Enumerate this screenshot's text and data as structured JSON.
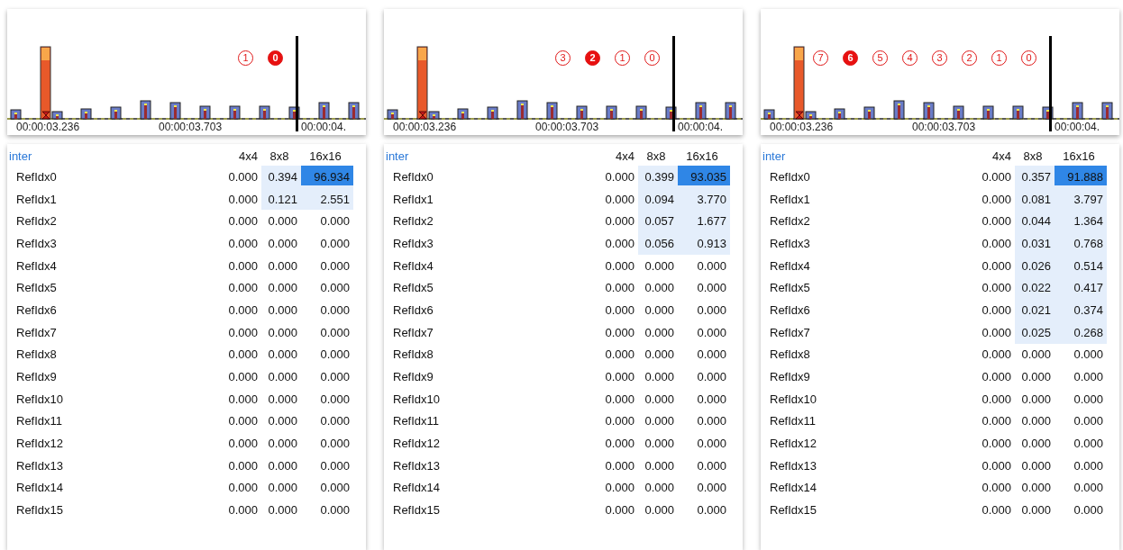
{
  "panels": [
    {
      "timeline": {
        "markers": [
          {
            "text": "1",
            "selected": false
          },
          {
            "text": "0",
            "selected": true
          }
        ],
        "times": [
          "00:00:03.236",
          "00:00:03.703",
          "00:00:04."
        ]
      },
      "table": {
        "title": "inter",
        "columns": [
          "4x4",
          "8x8",
          "16x16"
        ],
        "rows": [
          {
            "label": "RefIdx0",
            "cells": [
              {
                "value": "0.000",
                "highlighted": false,
                "selected": false
              },
              {
                "value": "0.394",
                "highlighted": true,
                "selected": false
              },
              {
                "value": "96.934",
                "highlighted": true,
                "selected": true
              }
            ]
          },
          {
            "label": "RefIdx1",
            "cells": [
              {
                "value": "0.000",
                "highlighted": false,
                "selected": false
              },
              {
                "value": "0.121",
                "highlighted": true,
                "selected": false
              },
              {
                "value": "2.551",
                "highlighted": true,
                "selected": false
              }
            ]
          },
          {
            "label": "RefIdx2",
            "cells": [
              {
                "value": "0.000",
                "highlighted": false,
                "selected": false
              },
              {
                "value": "0.000",
                "highlighted": false,
                "selected": false
              },
              {
                "value": "0.000",
                "highlighted": false,
                "selected": false
              }
            ]
          },
          {
            "label": "RefIdx3",
            "cells": [
              {
                "value": "0.000",
                "highlighted": false,
                "selected": false
              },
              {
                "value": "0.000",
                "highlighted": false,
                "selected": false
              },
              {
                "value": "0.000",
                "highlighted": false,
                "selected": false
              }
            ]
          },
          {
            "label": "RefIdx4",
            "cells": [
              {
                "value": "0.000",
                "highlighted": false,
                "selected": false
              },
              {
                "value": "0.000",
                "highlighted": false,
                "selected": false
              },
              {
                "value": "0.000",
                "highlighted": false,
                "selected": false
              }
            ]
          },
          {
            "label": "RefIdx5",
            "cells": [
              {
                "value": "0.000",
                "highlighted": false,
                "selected": false
              },
              {
                "value": "0.000",
                "highlighted": false,
                "selected": false
              },
              {
                "value": "0.000",
                "highlighted": false,
                "selected": false
              }
            ]
          },
          {
            "label": "RefIdx6",
            "cells": [
              {
                "value": "0.000",
                "highlighted": false,
                "selected": false
              },
              {
                "value": "0.000",
                "highlighted": false,
                "selected": false
              },
              {
                "value": "0.000",
                "highlighted": false,
                "selected": false
              }
            ]
          },
          {
            "label": "RefIdx7",
            "cells": [
              {
                "value": "0.000",
                "highlighted": false,
                "selected": false
              },
              {
                "value": "0.000",
                "highlighted": false,
                "selected": false
              },
              {
                "value": "0.000",
                "highlighted": false,
                "selected": false
              }
            ]
          },
          {
            "label": "RefIdx8",
            "cells": [
              {
                "value": "0.000",
                "highlighted": false,
                "selected": false
              },
              {
                "value": "0.000",
                "highlighted": false,
                "selected": false
              },
              {
                "value": "0.000",
                "highlighted": false,
                "selected": false
              }
            ]
          },
          {
            "label": "RefIdx9",
            "cells": [
              {
                "value": "0.000",
                "highlighted": false,
                "selected": false
              },
              {
                "value": "0.000",
                "highlighted": false,
                "selected": false
              },
              {
                "value": "0.000",
                "highlighted": false,
                "selected": false
              }
            ]
          },
          {
            "label": "RefIdx10",
            "cells": [
              {
                "value": "0.000",
                "highlighted": false,
                "selected": false
              },
              {
                "value": "0.000",
                "highlighted": false,
                "selected": false
              },
              {
                "value": "0.000",
                "highlighted": false,
                "selected": false
              }
            ]
          },
          {
            "label": "RefIdx11",
            "cells": [
              {
                "value": "0.000",
                "highlighted": false,
                "selected": false
              },
              {
                "value": "0.000",
                "highlighted": false,
                "selected": false
              },
              {
                "value": "0.000",
                "highlighted": false,
                "selected": false
              }
            ]
          },
          {
            "label": "RefIdx12",
            "cells": [
              {
                "value": "0.000",
                "highlighted": false,
                "selected": false
              },
              {
                "value": "0.000",
                "highlighted": false,
                "selected": false
              },
              {
                "value": "0.000",
                "highlighted": false,
                "selected": false
              }
            ]
          },
          {
            "label": "RefIdx13",
            "cells": [
              {
                "value": "0.000",
                "highlighted": false,
                "selected": false
              },
              {
                "value": "0.000",
                "highlighted": false,
                "selected": false
              },
              {
                "value": "0.000",
                "highlighted": false,
                "selected": false
              }
            ]
          },
          {
            "label": "RefIdx14",
            "cells": [
              {
                "value": "0.000",
                "highlighted": false,
                "selected": false
              },
              {
                "value": "0.000",
                "highlighted": false,
                "selected": false
              },
              {
                "value": "0.000",
                "highlighted": false,
                "selected": false
              }
            ]
          },
          {
            "label": "RefIdx15",
            "cells": [
              {
                "value": "0.000",
                "highlighted": false,
                "selected": false
              },
              {
                "value": "0.000",
                "highlighted": false,
                "selected": false
              },
              {
                "value": "0.000",
                "highlighted": false,
                "selected": false
              }
            ]
          }
        ]
      }
    },
    {
      "timeline": {
        "markers": [
          {
            "text": "3",
            "selected": false
          },
          {
            "text": "2",
            "selected": true
          },
          {
            "text": "1",
            "selected": false
          },
          {
            "text": "0",
            "selected": false
          }
        ],
        "times": [
          "00:00:03.236",
          "00:00:03.703",
          "00:00:04."
        ]
      },
      "table": {
        "title": "inter",
        "columns": [
          "4x4",
          "8x8",
          "16x16"
        ],
        "rows": [
          {
            "label": "RefIdx0",
            "cells": [
              {
                "value": "0.000",
                "highlighted": false,
                "selected": false
              },
              {
                "value": "0.399",
                "highlighted": true,
                "selected": false
              },
              {
                "value": "93.035",
                "highlighted": true,
                "selected": true
              }
            ]
          },
          {
            "label": "RefIdx1",
            "cells": [
              {
                "value": "0.000",
                "highlighted": false,
                "selected": false
              },
              {
                "value": "0.094",
                "highlighted": true,
                "selected": false
              },
              {
                "value": "3.770",
                "highlighted": true,
                "selected": false
              }
            ]
          },
          {
            "label": "RefIdx2",
            "cells": [
              {
                "value": "0.000",
                "highlighted": false,
                "selected": false
              },
              {
                "value": "0.057",
                "highlighted": true,
                "selected": false
              },
              {
                "value": "1.677",
                "highlighted": true,
                "selected": false
              }
            ]
          },
          {
            "label": "RefIdx3",
            "cells": [
              {
                "value": "0.000",
                "highlighted": false,
                "selected": false
              },
              {
                "value": "0.056",
                "highlighted": true,
                "selected": false
              },
              {
                "value": "0.913",
                "highlighted": true,
                "selected": false
              }
            ]
          },
          {
            "label": "RefIdx4",
            "cells": [
              {
                "value": "0.000",
                "highlighted": false,
                "selected": false
              },
              {
                "value": "0.000",
                "highlighted": false,
                "selected": false
              },
              {
                "value": "0.000",
                "highlighted": false,
                "selected": false
              }
            ]
          },
          {
            "label": "RefIdx5",
            "cells": [
              {
                "value": "0.000",
                "highlighted": false,
                "selected": false
              },
              {
                "value": "0.000",
                "highlighted": false,
                "selected": false
              },
              {
                "value": "0.000",
                "highlighted": false,
                "selected": false
              }
            ]
          },
          {
            "label": "RefIdx6",
            "cells": [
              {
                "value": "0.000",
                "highlighted": false,
                "selected": false
              },
              {
                "value": "0.000",
                "highlighted": false,
                "selected": false
              },
              {
                "value": "0.000",
                "highlighted": false,
                "selected": false
              }
            ]
          },
          {
            "label": "RefIdx7",
            "cells": [
              {
                "value": "0.000",
                "highlighted": false,
                "selected": false
              },
              {
                "value": "0.000",
                "highlighted": false,
                "selected": false
              },
              {
                "value": "0.000",
                "highlighted": false,
                "selected": false
              }
            ]
          },
          {
            "label": "RefIdx8",
            "cells": [
              {
                "value": "0.000",
                "highlighted": false,
                "selected": false
              },
              {
                "value": "0.000",
                "highlighted": false,
                "selected": false
              },
              {
                "value": "0.000",
                "highlighted": false,
                "selected": false
              }
            ]
          },
          {
            "label": "RefIdx9",
            "cells": [
              {
                "value": "0.000",
                "highlighted": false,
                "selected": false
              },
              {
                "value": "0.000",
                "highlighted": false,
                "selected": false
              },
              {
                "value": "0.000",
                "highlighted": false,
                "selected": false
              }
            ]
          },
          {
            "label": "RefIdx10",
            "cells": [
              {
                "value": "0.000",
                "highlighted": false,
                "selected": false
              },
              {
                "value": "0.000",
                "highlighted": false,
                "selected": false
              },
              {
                "value": "0.000",
                "highlighted": false,
                "selected": false
              }
            ]
          },
          {
            "label": "RefIdx11",
            "cells": [
              {
                "value": "0.000",
                "highlighted": false,
                "selected": false
              },
              {
                "value": "0.000",
                "highlighted": false,
                "selected": false
              },
              {
                "value": "0.000",
                "highlighted": false,
                "selected": false
              }
            ]
          },
          {
            "label": "RefIdx12",
            "cells": [
              {
                "value": "0.000",
                "highlighted": false,
                "selected": false
              },
              {
                "value": "0.000",
                "highlighted": false,
                "selected": false
              },
              {
                "value": "0.000",
                "highlighted": false,
                "selected": false
              }
            ]
          },
          {
            "label": "RefIdx13",
            "cells": [
              {
                "value": "0.000",
                "highlighted": false,
                "selected": false
              },
              {
                "value": "0.000",
                "highlighted": false,
                "selected": false
              },
              {
                "value": "0.000",
                "highlighted": false,
                "selected": false
              }
            ]
          },
          {
            "label": "RefIdx14",
            "cells": [
              {
                "value": "0.000",
                "highlighted": false,
                "selected": false
              },
              {
                "value": "0.000",
                "highlighted": false,
                "selected": false
              },
              {
                "value": "0.000",
                "highlighted": false,
                "selected": false
              }
            ]
          },
          {
            "label": "RefIdx15",
            "cells": [
              {
                "value": "0.000",
                "highlighted": false,
                "selected": false
              },
              {
                "value": "0.000",
                "highlighted": false,
                "selected": false
              },
              {
                "value": "0.000",
                "highlighted": false,
                "selected": false
              }
            ]
          }
        ]
      }
    },
    {
      "timeline": {
        "markers": [
          {
            "text": "7",
            "selected": false
          },
          {
            "text": "6",
            "selected": true
          },
          {
            "text": "5",
            "selected": false
          },
          {
            "text": "4",
            "selected": false
          },
          {
            "text": "3",
            "selected": false
          },
          {
            "text": "2",
            "selected": false
          },
          {
            "text": "1",
            "selected": false
          },
          {
            "text": "0",
            "selected": false
          }
        ],
        "times": [
          "00:00:03.236",
          "00:00:03.703",
          "00:00:04."
        ]
      },
      "table": {
        "title": "inter",
        "columns": [
          "4x4",
          "8x8",
          "16x16"
        ],
        "rows": [
          {
            "label": "RefIdx0",
            "cells": [
              {
                "value": "0.000",
                "highlighted": false,
                "selected": false
              },
              {
                "value": "0.357",
                "highlighted": true,
                "selected": false
              },
              {
                "value": "91.888",
                "highlighted": true,
                "selected": true
              }
            ]
          },
          {
            "label": "RefIdx1",
            "cells": [
              {
                "value": "0.000",
                "highlighted": false,
                "selected": false
              },
              {
                "value": "0.081",
                "highlighted": true,
                "selected": false
              },
              {
                "value": "3.797",
                "highlighted": true,
                "selected": false
              }
            ]
          },
          {
            "label": "RefIdx2",
            "cells": [
              {
                "value": "0.000",
                "highlighted": false,
                "selected": false
              },
              {
                "value": "0.044",
                "highlighted": true,
                "selected": false
              },
              {
                "value": "1.364",
                "highlighted": true,
                "selected": false
              }
            ]
          },
          {
            "label": "RefIdx3",
            "cells": [
              {
                "value": "0.000",
                "highlighted": false,
                "selected": false
              },
              {
                "value": "0.031",
                "highlighted": true,
                "selected": false
              },
              {
                "value": "0.768",
                "highlighted": true,
                "selected": false
              }
            ]
          },
          {
            "label": "RefIdx4",
            "cells": [
              {
                "value": "0.000",
                "highlighted": false,
                "selected": false
              },
              {
                "value": "0.026",
                "highlighted": true,
                "selected": false
              },
              {
                "value": "0.514",
                "highlighted": true,
                "selected": false
              }
            ]
          },
          {
            "label": "RefIdx5",
            "cells": [
              {
                "value": "0.000",
                "highlighted": false,
                "selected": false
              },
              {
                "value": "0.022",
                "highlighted": true,
                "selected": false
              },
              {
                "value": "0.417",
                "highlighted": true,
                "selected": false
              }
            ]
          },
          {
            "label": "RefIdx6",
            "cells": [
              {
                "value": "0.000",
                "highlighted": false,
                "selected": false
              },
              {
                "value": "0.021",
                "highlighted": true,
                "selected": false
              },
              {
                "value": "0.374",
                "highlighted": true,
                "selected": false
              }
            ]
          },
          {
            "label": "RefIdx7",
            "cells": [
              {
                "value": "0.000",
                "highlighted": false,
                "selected": false
              },
              {
                "value": "0.025",
                "highlighted": true,
                "selected": false
              },
              {
                "value": "0.268",
                "highlighted": true,
                "selected": false
              }
            ]
          },
          {
            "label": "RefIdx8",
            "cells": [
              {
                "value": "0.000",
                "highlighted": false,
                "selected": false
              },
              {
                "value": "0.000",
                "highlighted": false,
                "selected": false
              },
              {
                "value": "0.000",
                "highlighted": false,
                "selected": false
              }
            ]
          },
          {
            "label": "RefIdx9",
            "cells": [
              {
                "value": "0.000",
                "highlighted": false,
                "selected": false
              },
              {
                "value": "0.000",
                "highlighted": false,
                "selected": false
              },
              {
                "value": "0.000",
                "highlighted": false,
                "selected": false
              }
            ]
          },
          {
            "label": "RefIdx10",
            "cells": [
              {
                "value": "0.000",
                "highlighted": false,
                "selected": false
              },
              {
                "value": "0.000",
                "highlighted": false,
                "selected": false
              },
              {
                "value": "0.000",
                "highlighted": false,
                "selected": false
              }
            ]
          },
          {
            "label": "RefIdx11",
            "cells": [
              {
                "value": "0.000",
                "highlighted": false,
                "selected": false
              },
              {
                "value": "0.000",
                "highlighted": false,
                "selected": false
              },
              {
                "value": "0.000",
                "highlighted": false,
                "selected": false
              }
            ]
          },
          {
            "label": "RefIdx12",
            "cells": [
              {
                "value": "0.000",
                "highlighted": false,
                "selected": false
              },
              {
                "value": "0.000",
                "highlighted": false,
                "selected": false
              },
              {
                "value": "0.000",
                "highlighted": false,
                "selected": false
              }
            ]
          },
          {
            "label": "RefIdx13",
            "cells": [
              {
                "value": "0.000",
                "highlighted": false,
                "selected": false
              },
              {
                "value": "0.000",
                "highlighted": false,
                "selected": false
              },
              {
                "value": "0.000",
                "highlighted": false,
                "selected": false
              }
            ]
          },
          {
            "label": "RefIdx14",
            "cells": [
              {
                "value": "0.000",
                "highlighted": false,
                "selected": false
              },
              {
                "value": "0.000",
                "highlighted": false,
                "selected": false
              },
              {
                "value": "0.000",
                "highlighted": false,
                "selected": false
              }
            ]
          },
          {
            "label": "RefIdx15",
            "cells": [
              {
                "value": "0.000",
                "highlighted": false,
                "selected": false
              },
              {
                "value": "0.000",
                "highlighted": false,
                "selected": false
              },
              {
                "value": "0.000",
                "highlighted": false,
                "selected": false
              }
            ]
          }
        ]
      }
    }
  ]
}
